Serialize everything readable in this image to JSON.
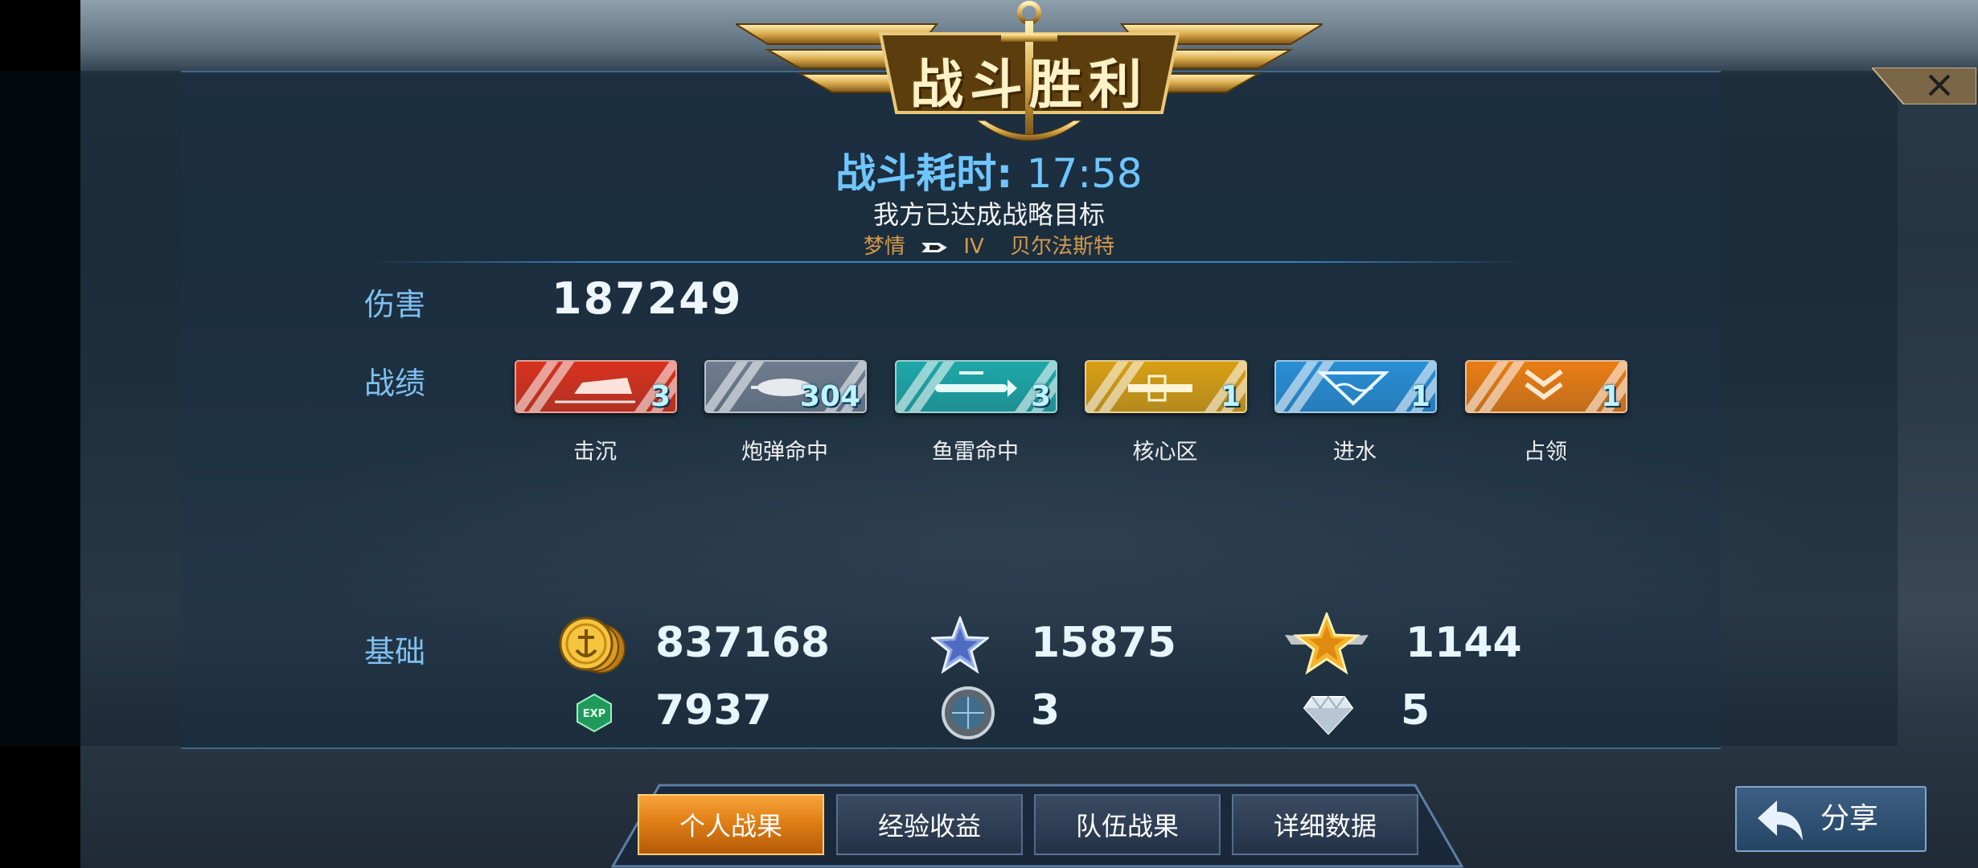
{
  "banner": {
    "title": "战斗胜利"
  },
  "battle": {
    "time_label": "战斗耗时:",
    "time_value": "17:58",
    "goal_text": "我方已达成战略目标",
    "player_name": "梦情",
    "tier": "IV",
    "ship_name": "贝尔法斯特"
  },
  "damage": {
    "label": "伤害",
    "value": "187249"
  },
  "record": {
    "label": "战绩",
    "items": [
      {
        "label": "击沉",
        "count": "3",
        "color": "#d8321e",
        "icon": "ship-sinking-icon"
      },
      {
        "label": "炮弹命中",
        "count": "304",
        "color": "#6f7d8f",
        "icon": "shell-icon"
      },
      {
        "label": "鱼雷命中",
        "count": "3",
        "color": "#1fa8a8",
        "icon": "torpedo-icon"
      },
      {
        "label": "核心区",
        "count": "1",
        "color": "#d9a014",
        "icon": "citadel-icon"
      },
      {
        "label": "进水",
        "count": "1",
        "color": "#2a8fd6",
        "icon": "flooding-icon"
      },
      {
        "label": "占领",
        "count": "1",
        "color": "#ea7d14",
        "icon": "capture-chevron-icon"
      }
    ]
  },
  "basic": {
    "label": "基础",
    "silver": "837168",
    "star_points": "15875",
    "rank_points": "1144",
    "exp": "7937",
    "tokens": "3",
    "diamonds": "5"
  },
  "tabs": [
    {
      "label": "个人战果",
      "active": true
    },
    {
      "label": "经验收益",
      "active": false
    },
    {
      "label": "队伍战果",
      "active": false
    },
    {
      "label": "详细数据",
      "active": false
    }
  ],
  "share": {
    "label": "分享"
  },
  "close": {
    "label": "✕"
  }
}
